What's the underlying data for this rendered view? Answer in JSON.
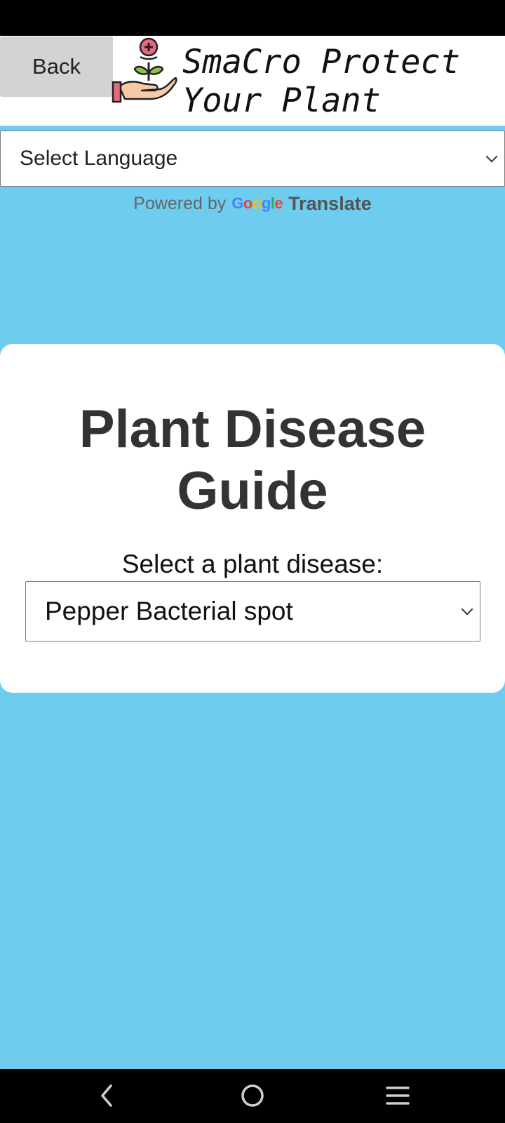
{
  "header": {
    "back_label": "Back",
    "title": "SmaCro Protect\nYour Plant",
    "logo_icon": "hand-holding-plant-icon"
  },
  "language": {
    "selected": "Select Language",
    "powered_by": "Powered by",
    "google": [
      "G",
      "o",
      "o",
      "g",
      "l",
      "e"
    ],
    "translate": "Translate"
  },
  "card": {
    "title": "Plant Disease\nGuide",
    "label": "Select a plant disease:",
    "selected_disease": "Pepper Bacterial spot"
  },
  "nav": {
    "back_icon": "nav-back-icon",
    "home_icon": "nav-home-icon",
    "menu_icon": "nav-menu-icon"
  },
  "colors": {
    "background": "#6ecdee",
    "card": "#ffffff",
    "back_button": "#d3d3d3",
    "title_text": "#333333",
    "google_blue": "#4285F4",
    "google_red": "#EA4335",
    "google_yellow": "#FBBC05",
    "google_green": "#34A853"
  }
}
